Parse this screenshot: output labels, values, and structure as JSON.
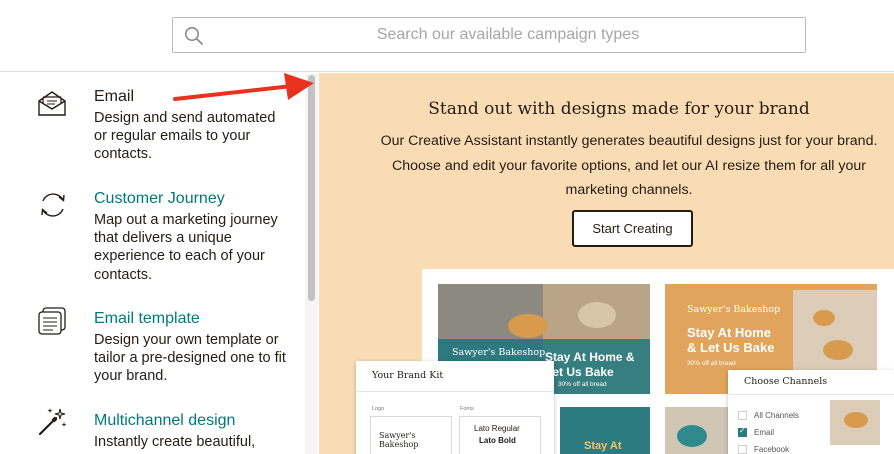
{
  "search": {
    "placeholder": "Search our available campaign types",
    "value": ""
  },
  "sidebar": {
    "items": [
      {
        "title": "Email",
        "description": "Design and send automated or regular emails to your contacts.",
        "icon": "envelope-icon"
      },
      {
        "title": "Customer Journey",
        "description": "Map out a marketing journey that delivers a unique experience to each of your contacts.",
        "icon": "cycle-arrows-icon"
      },
      {
        "title": "Email template",
        "description": "Design your own template or tailor a pre-designed one to fit your brand.",
        "icon": "template-stack-icon"
      },
      {
        "title": "Multichannel design",
        "description": "Instantly create beautiful,",
        "icon": "magic-wand-icon"
      }
    ]
  },
  "main": {
    "headline": "Stand out with designs made for your brand",
    "body": "Our Creative Assistant instantly generates beautiful designs just for your brand. Choose and edit your favorite options, and let our AI resize them for all your marketing channels.",
    "cta_label": "Start Creating"
  },
  "preview": {
    "tile1": {
      "brand": "Sawyer's Bakeshop",
      "headline": "Stay At Home & Let Us Bake",
      "sub": "30% off all bread"
    },
    "tile2": {
      "brand": "Sawyer's Bakeshop",
      "headline": "Stay At Home & Let Us Bake",
      "sub": "30% off all bread"
    },
    "tile3": {
      "headline": "Stay At"
    },
    "brand_kit": {
      "title": "Your Brand Kit",
      "logo_label": "Logo",
      "fonts_label": "Fonts",
      "logo_text": "Sawyer's Bakeshop",
      "font_regular": "Lato Regular",
      "font_bold": "Lato Bold"
    },
    "channels": {
      "title": "Choose Channels",
      "options": [
        {
          "label": "All Channels",
          "checked": false
        },
        {
          "label": "Email",
          "checked": true
        },
        {
          "label": "Facebook",
          "checked": false
        }
      ]
    }
  },
  "colors": {
    "accent_teal": "#00797d",
    "banner_bg": "#f9dcb3",
    "annotation_red": "#e8321e"
  }
}
